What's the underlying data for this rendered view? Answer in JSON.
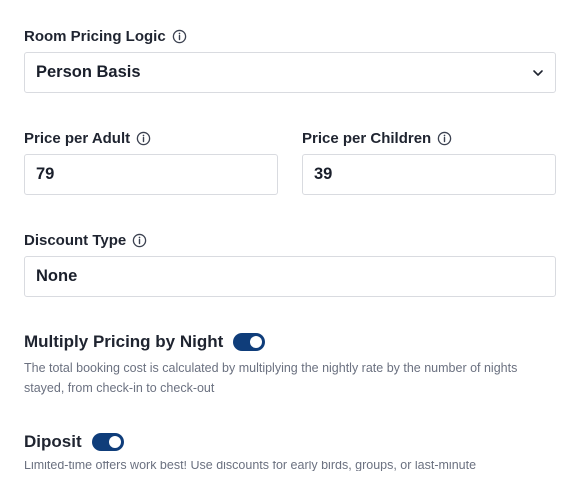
{
  "room_pricing": {
    "label": "Room Pricing Logic",
    "value": "Person Basis",
    "info_icon": "info-icon",
    "chevron_icon": "chevron-down-icon"
  },
  "price_adult": {
    "label": "Price per Adult",
    "value": "79"
  },
  "price_children": {
    "label": "Price per Children",
    "value": "39"
  },
  "discount": {
    "label": "Discount Type",
    "value": "None"
  },
  "multiply_night": {
    "label": "Multiply Pricing by Night",
    "enabled": true,
    "description": "The total booking cost is calculated by multiplying the nightly rate by the number of nights stayed, from check-in to check-out"
  },
  "deposit": {
    "label": "Diposit",
    "enabled": true,
    "description": "Limited-time offers work best! Use discounts for early birds, groups, or last-minute"
  },
  "colors": {
    "toggle_on": "#0f3d7a",
    "border": "#d9dbe0",
    "muted_text": "#6b7180"
  }
}
